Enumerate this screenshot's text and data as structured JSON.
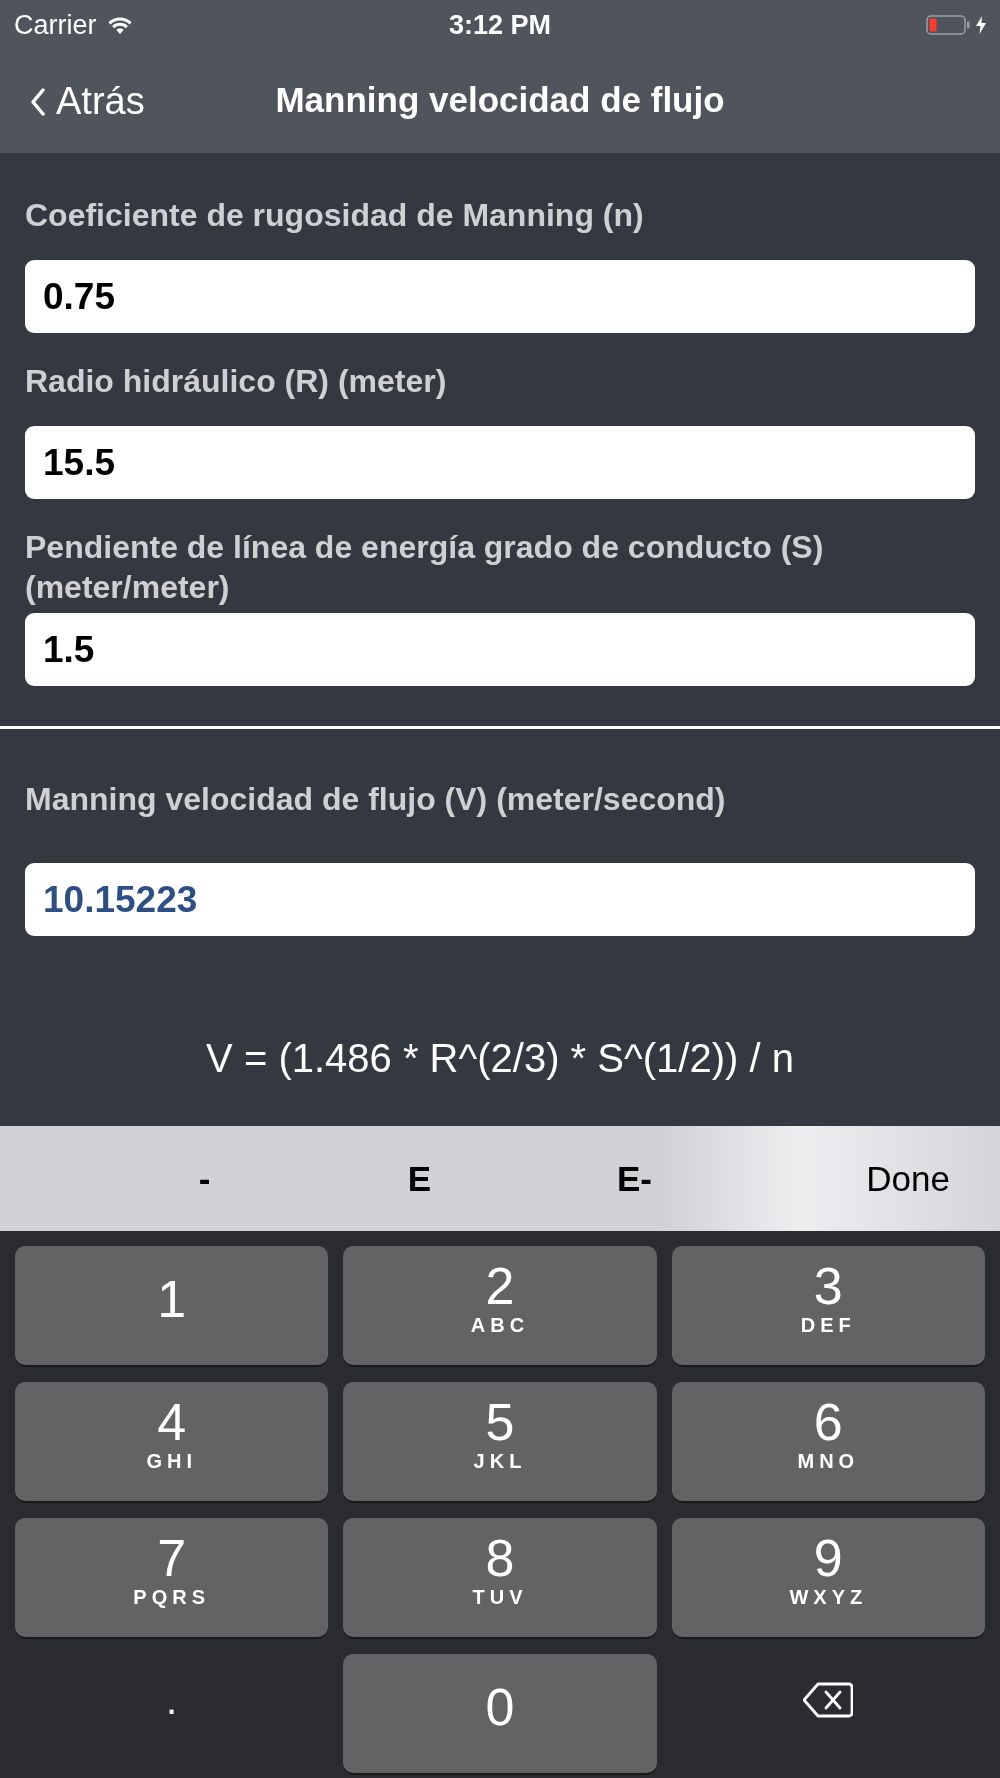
{
  "status_bar": {
    "carrier": "Carrier",
    "time": "3:12 PM"
  },
  "nav": {
    "back": "Atrás",
    "title": "Manning velocidad de flujo"
  },
  "fields": [
    {
      "label": "Coeficiente de rugosidad de Manning (n)",
      "value": "0.75"
    },
    {
      "label": "Radio hidráulico (R) (meter)",
      "value": "15.5"
    },
    {
      "label": "Pendiente de línea de energía grado de conducto (S) (meter/meter)",
      "value": "1.5"
    }
  ],
  "result": {
    "label": "Manning velocidad de flujo (V) (meter/second)",
    "value": "10.15223"
  },
  "formula": "V = (1.486 * R^(2/3) * S^(1/2)) / n",
  "toolbar": [
    {
      "kind": "symbol",
      "label": "-"
    },
    {
      "kind": "symbol",
      "label": "E"
    },
    {
      "kind": "symbol",
      "label": "E-"
    },
    {
      "kind": "done",
      "label": "Done"
    }
  ],
  "keys": [
    {
      "kind": "digit",
      "digit": "1"
    },
    {
      "kind": "digit",
      "digit": "2",
      "letters": "ABC"
    },
    {
      "kind": "digit",
      "digit": "3",
      "letters": "DEF"
    },
    {
      "kind": "digit",
      "digit": "4",
      "letters": "GHI"
    },
    {
      "kind": "digit",
      "digit": "5",
      "letters": "JKL"
    },
    {
      "kind": "digit",
      "digit": "6",
      "letters": "MNO"
    },
    {
      "kind": "digit",
      "digit": "7",
      "letters": "PQRS"
    },
    {
      "kind": "digit",
      "digit": "8",
      "letters": "TUV"
    },
    {
      "kind": "digit",
      "digit": "9",
      "letters": "WXYZ"
    },
    {
      "kind": "plain",
      "digit": "."
    },
    {
      "kind": "digit",
      "digit": "0"
    },
    {
      "kind": "delete"
    }
  ]
}
